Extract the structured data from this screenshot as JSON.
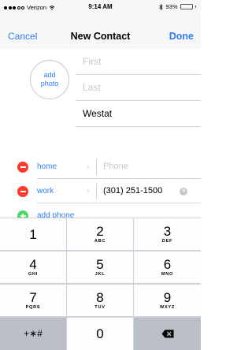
{
  "status_bar": {
    "carrier": "Verizon",
    "time": "9:14 AM",
    "battery_percent": "93%",
    "battery_level": 0.93,
    "bluetooth_icon": "bluetooth-icon"
  },
  "nav": {
    "cancel_label": "Cancel",
    "title": "New Contact",
    "done_label": "Done"
  },
  "photo": {
    "line1": "add",
    "line2": "photo"
  },
  "name_fields": {
    "first_placeholder": "First",
    "last_placeholder": "Last",
    "company_value": "Westat"
  },
  "phones": [
    {
      "label": "home",
      "placeholder": "Phone",
      "value": ""
    },
    {
      "label": "work",
      "placeholder": "",
      "value": "(301) 251-1500"
    }
  ],
  "add_phone_label": "add phone",
  "keypad": {
    "keys": [
      {
        "num": "1",
        "letters": ""
      },
      {
        "num": "2",
        "letters": "ABC"
      },
      {
        "num": "3",
        "letters": "DEF"
      },
      {
        "num": "4",
        "letters": "GHI"
      },
      {
        "num": "5",
        "letters": "JKL"
      },
      {
        "num": "6",
        "letters": "MNO"
      },
      {
        "num": "7",
        "letters": "PQRS"
      },
      {
        "num": "8",
        "letters": "TUV"
      },
      {
        "num": "9",
        "letters": "WXYZ"
      },
      {
        "num": "+∗#",
        "letters": ""
      },
      {
        "num": "0",
        "letters": ""
      },
      {
        "num": "",
        "letters": "",
        "icon": "delete-icon"
      }
    ]
  },
  "colors": {
    "accent": "#2e7cf6",
    "delete_red": "#ff3b30",
    "add_green": "#4cd964"
  }
}
